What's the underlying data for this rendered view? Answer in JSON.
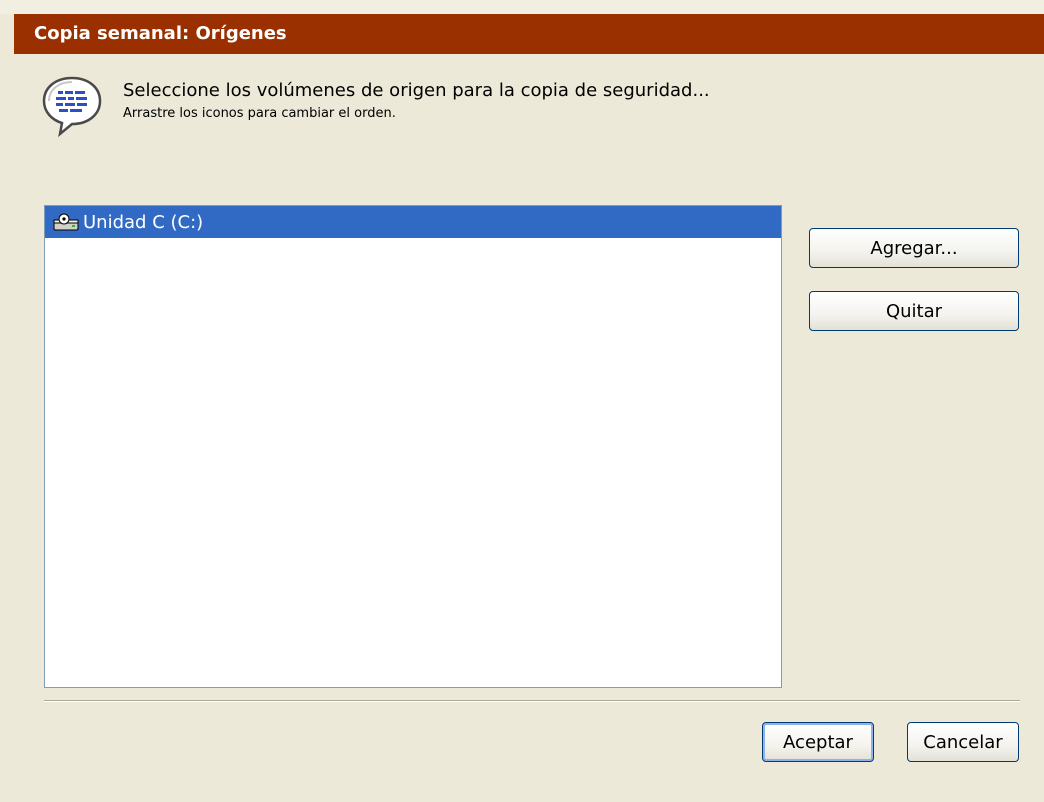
{
  "dialog": {
    "title": "Copia semanal: Orígenes",
    "instruction": "Seleccione los volúmenes de origen para la copia de seguridad...",
    "hint": "Arrastre los iconos para cambiar el orden.",
    "header_icon": "speech-bubble-info-icon"
  },
  "sources": {
    "items": [
      {
        "label": "Unidad C (C:)",
        "icon": "hard-drive-icon",
        "selected": true
      }
    ]
  },
  "buttons": {
    "add": "Agregar...",
    "remove": "Quitar",
    "ok": "Aceptar",
    "cancel": "Cancelar"
  },
  "colors": {
    "title_bar": "#9A3000",
    "selection": "#316AC5",
    "dialog_bg": "#ECE9D8"
  }
}
